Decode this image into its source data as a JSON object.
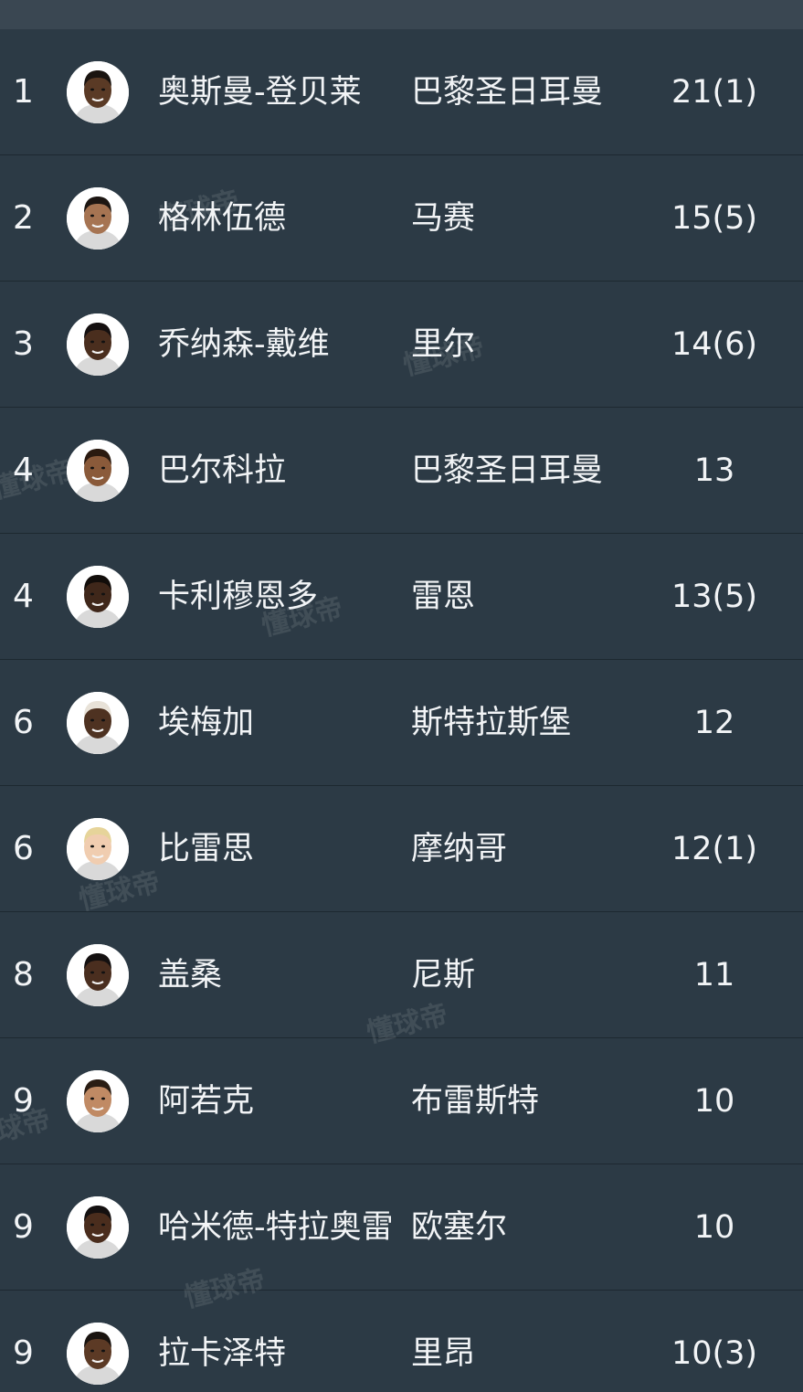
{
  "rows": [
    {
      "rank": "1",
      "name": "奥斯曼-登贝莱",
      "team": "巴黎圣日耳曼",
      "goals": "21(1)",
      "skin": "#5a3a25",
      "hair": "#1a1410"
    },
    {
      "rank": "2",
      "name": "格林伍德",
      "team": "马赛",
      "goals": "15(5)",
      "skin": "#a67452",
      "hair": "#1c1612"
    },
    {
      "rank": "3",
      "name": "乔纳森-戴维",
      "team": "里尔",
      "goals": "14(6)",
      "skin": "#4a2e1e",
      "hair": "#151010"
    },
    {
      "rank": "4",
      "name": "巴尔科拉",
      "team": "巴黎圣日耳曼",
      "goals": "13",
      "skin": "#8a5a3a",
      "hair": "#2a1a10"
    },
    {
      "rank": "4",
      "name": "卡利穆恩多",
      "team": "雷恩",
      "goals": "13(5)",
      "skin": "#3f271a",
      "hair": "#120d0a"
    },
    {
      "rank": "6",
      "name": "埃梅加",
      "team": "斯特拉斯堡",
      "goals": "12",
      "skin": "#4e3221",
      "hair": "#e8e2d8"
    },
    {
      "rank": "6",
      "name": "比雷思",
      "team": "摩纳哥",
      "goals": "12(1)",
      "skin": "#f0cdb0",
      "hair": "#e6d49a"
    },
    {
      "rank": "8",
      "name": "盖桑",
      "team": "尼斯",
      "goals": "11",
      "skin": "#4a2e1f",
      "hair": "#141010"
    },
    {
      "rank": "9",
      "name": "阿若克",
      "team": "布雷斯特",
      "goals": "10",
      "skin": "#c08a64",
      "hair": "#2a1d14"
    },
    {
      "rank": "9",
      "name": "哈米德-特拉奥雷",
      "team": "欧塞尔",
      "goals": "10",
      "skin": "#4a2d1d",
      "hair": "#141010"
    },
    {
      "rank": "9",
      "name": "拉卡泽特",
      "team": "里昂",
      "goals": "10(3)",
      "skin": "#5c3a25",
      "hair": "#1a1410"
    }
  ],
  "watermark": "懂球帝"
}
